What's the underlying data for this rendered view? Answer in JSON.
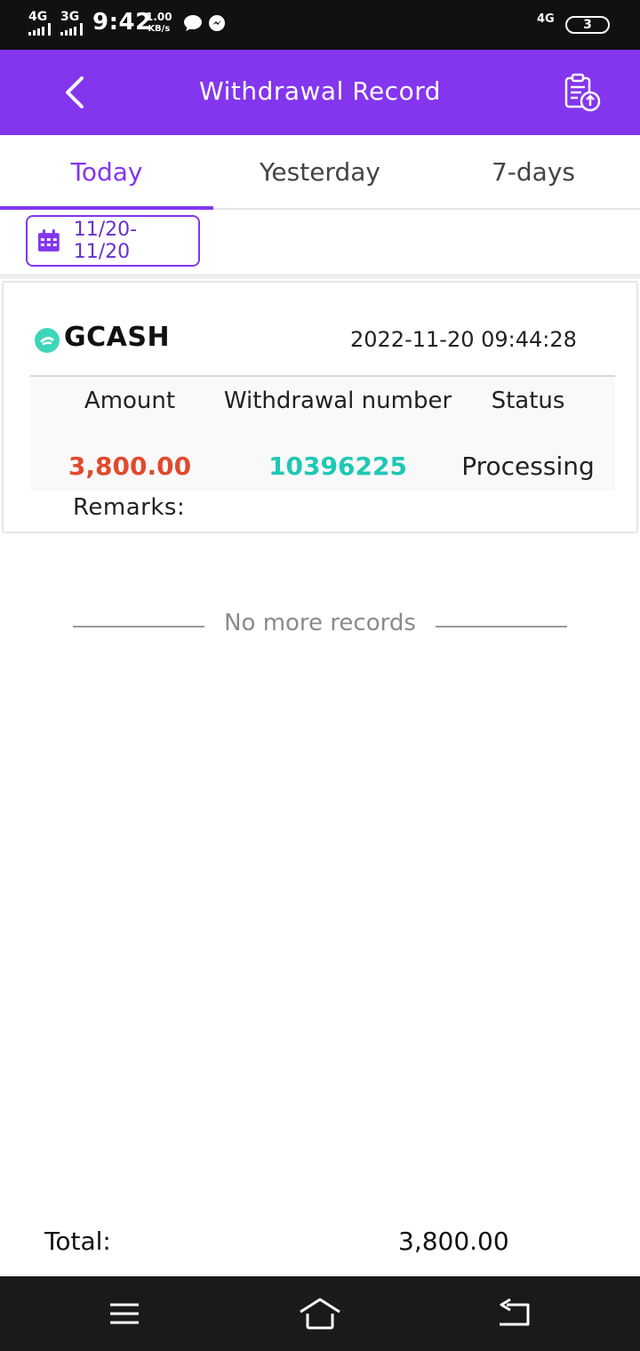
{
  "status_bar": {
    "net1": "4G",
    "net2": "3G",
    "time": "9:42",
    "speed_value": "1.00",
    "speed_unit": "KB/s",
    "net_right": "4G",
    "battery": "3"
  },
  "header": {
    "title": "Withdrawal Record",
    "back_icon": "chevron-left-icon",
    "export_icon": "clipboard-upload-icon",
    "color": "#8336ee"
  },
  "tabs": [
    {
      "label": "Today",
      "active": true
    },
    {
      "label": "Yesterday",
      "active": false
    },
    {
      "label": "7-days",
      "active": false
    }
  ],
  "date_range": {
    "label": "11/20- 11/20",
    "icon": "calendar-icon"
  },
  "record": {
    "method": "GCASH",
    "datetime": "2022-11-20 09:44:28",
    "columns": [
      "Amount",
      "Withdrawal number",
      "Status"
    ],
    "amount": "3,800.00",
    "withdrawal_number": "10396225",
    "status": "Processing",
    "remarks_label": "Remarks:",
    "amount_color": "#e04a2c",
    "number_color": "#1fc8b3"
  },
  "list_end": "No more records",
  "total": {
    "label": "Total:",
    "value": "3,800.00"
  },
  "nav": {
    "menu_icon": "menu-icon",
    "home_icon": "home-icon",
    "back_icon": "back-icon"
  }
}
